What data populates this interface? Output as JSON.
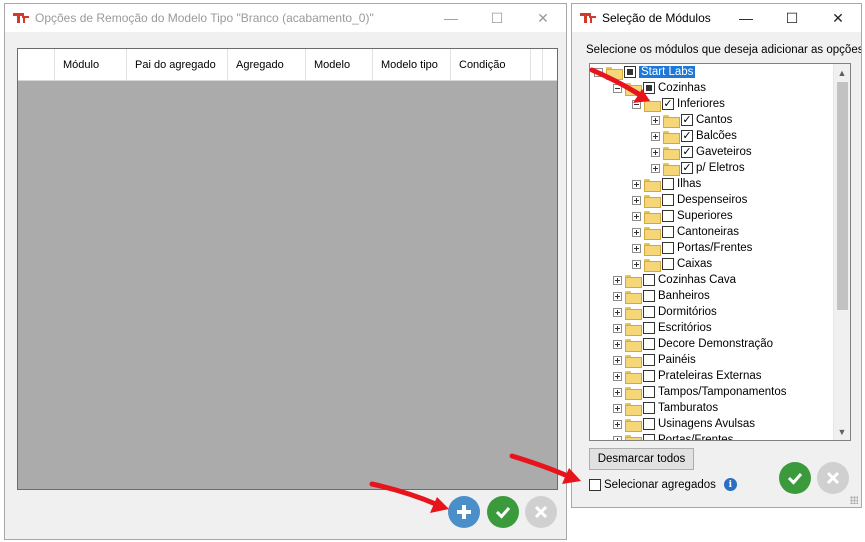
{
  "left_window": {
    "title": "Opções de Remoção do Modelo Tipo \"Branco (acabamento_0)\"",
    "controls": {
      "minimize": "—",
      "maximize": "☐",
      "close": "✕"
    },
    "grid": {
      "columns": [
        "",
        "Módulo",
        "Pai do agregado",
        "Agregado",
        "Modelo",
        "Modelo tipo",
        "Condição",
        ""
      ]
    },
    "buttons": {
      "add_icon": "plus-icon",
      "confirm_icon": "check-icon",
      "cancel_icon": "x-icon"
    }
  },
  "right_window": {
    "title": "Seleção de Módulos",
    "controls": {
      "minimize": "—",
      "maximize": "☐",
      "close": "✕"
    },
    "instruction": "Selecione os módulos que deseja adicionar as opções de",
    "tree": [
      {
        "label": "Start Labs",
        "level": 0,
        "expander": "minus",
        "check": "partial",
        "selected": true
      },
      {
        "label": "Cozinhas",
        "level": 1,
        "expander": "minus",
        "check": "partial"
      },
      {
        "label": "Inferiores",
        "level": 2,
        "expander": "minus",
        "check": "checked"
      },
      {
        "label": "Cantos",
        "level": 3,
        "expander": "plus",
        "check": "checked"
      },
      {
        "label": "Balcões",
        "level": 3,
        "expander": "plus",
        "check": "checked"
      },
      {
        "label": "Gaveteiros",
        "level": 3,
        "expander": "plus",
        "check": "checked"
      },
      {
        "label": "p/ Eletros",
        "level": 3,
        "expander": "plus",
        "check": "checked"
      },
      {
        "label": "Ilhas",
        "level": 2,
        "expander": "plus",
        "check": "unchecked"
      },
      {
        "label": "Despenseiros",
        "level": 2,
        "expander": "plus",
        "check": "unchecked"
      },
      {
        "label": "Superiores",
        "level": 2,
        "expander": "plus",
        "check": "unchecked"
      },
      {
        "label": "Cantoneiras",
        "level": 2,
        "expander": "plus",
        "check": "unchecked"
      },
      {
        "label": "Portas/Frentes",
        "level": 2,
        "expander": "plus",
        "check": "unchecked"
      },
      {
        "label": "Caixas",
        "level": 2,
        "expander": "plus",
        "check": "unchecked"
      },
      {
        "label": "Cozinhas Cava",
        "level": 1,
        "expander": "plus",
        "check": "unchecked"
      },
      {
        "label": "Banheiros",
        "level": 1,
        "expander": "plus",
        "check": "unchecked"
      },
      {
        "label": "Dormitórios",
        "level": 1,
        "expander": "plus",
        "check": "unchecked"
      },
      {
        "label": "Escritórios",
        "level": 1,
        "expander": "plus",
        "check": "unchecked"
      },
      {
        "label": "Decore Demonstração",
        "level": 1,
        "expander": "plus",
        "check": "unchecked"
      },
      {
        "label": "Painéis",
        "level": 1,
        "expander": "plus",
        "check": "unchecked"
      },
      {
        "label": "Prateleiras Externas",
        "level": 1,
        "expander": "plus",
        "check": "unchecked"
      },
      {
        "label": "Tampos/Tamponamentos",
        "level": 1,
        "expander": "plus",
        "check": "unchecked"
      },
      {
        "label": "Tamburatos",
        "level": 1,
        "expander": "plus",
        "check": "unchecked"
      },
      {
        "label": "Usinagens Avulsas",
        "level": 1,
        "expander": "plus",
        "check": "unchecked"
      },
      {
        "label": "Portas/Frentes",
        "level": 1,
        "expander": "plus",
        "check": "unchecked"
      }
    ],
    "desmarcar_button": "Desmarcar todos",
    "selecionar_agregados": {
      "label": "Selecionar agregados",
      "checked": false
    },
    "info_icon": "i",
    "buttons": {
      "confirm_icon": "check-icon",
      "cancel_icon": "x-icon"
    }
  },
  "colors": {
    "accent_red": "#d23a2a",
    "blue_button": "#4a8fc9",
    "green_button": "#3b9a3c",
    "disabled_button": "#d0d0d0",
    "selection": "#1e78d7",
    "annotation_arrow": "#e8141c"
  }
}
